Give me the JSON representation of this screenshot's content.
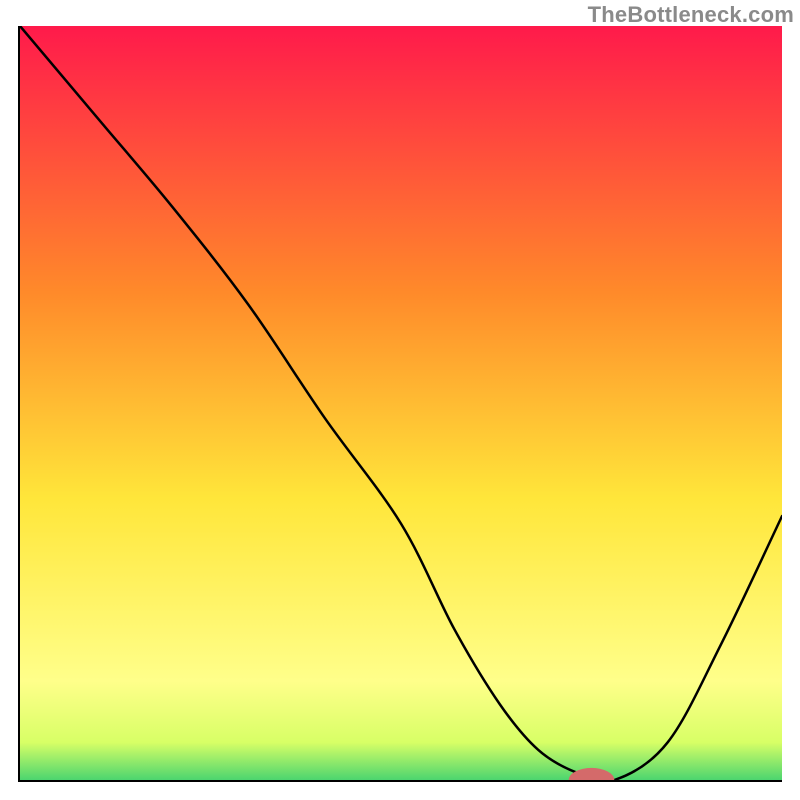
{
  "watermark": "TheBottleneck.com",
  "colors": {
    "top": "#ff1a4b",
    "mid_orange": "#ff8a2a",
    "mid_yellow": "#ffe63a",
    "pale_yellow": "#ffff8a",
    "green": "#2ecc71",
    "marker": "#d46a6a",
    "axis": "#000000"
  },
  "chart_data": {
    "type": "line",
    "title": "",
    "xlabel": "",
    "ylabel": "",
    "xlim": [
      0,
      100
    ],
    "ylim": [
      0,
      100
    ],
    "x": [
      0,
      10,
      20,
      30,
      40,
      50,
      57,
      63,
      68,
      73,
      78,
      85,
      92,
      100
    ],
    "values": [
      100,
      88,
      76,
      63,
      48,
      34,
      20,
      10,
      4,
      1,
      0,
      5,
      18,
      35
    ],
    "marker": {
      "x": 75,
      "y": 0,
      "rx": 3.0,
      "ry": 1.6
    },
    "gradient_stops": [
      {
        "offset": 0,
        "color": "#ff1a4b"
      },
      {
        "offset": 35,
        "color": "#ff8a2a"
      },
      {
        "offset": 62,
        "color": "#ffe63a"
      },
      {
        "offset": 86,
        "color": "#ffff8a"
      },
      {
        "offset": 94,
        "color": "#d8ff66"
      },
      {
        "offset": 100,
        "color": "#2ecc71"
      }
    ]
  }
}
